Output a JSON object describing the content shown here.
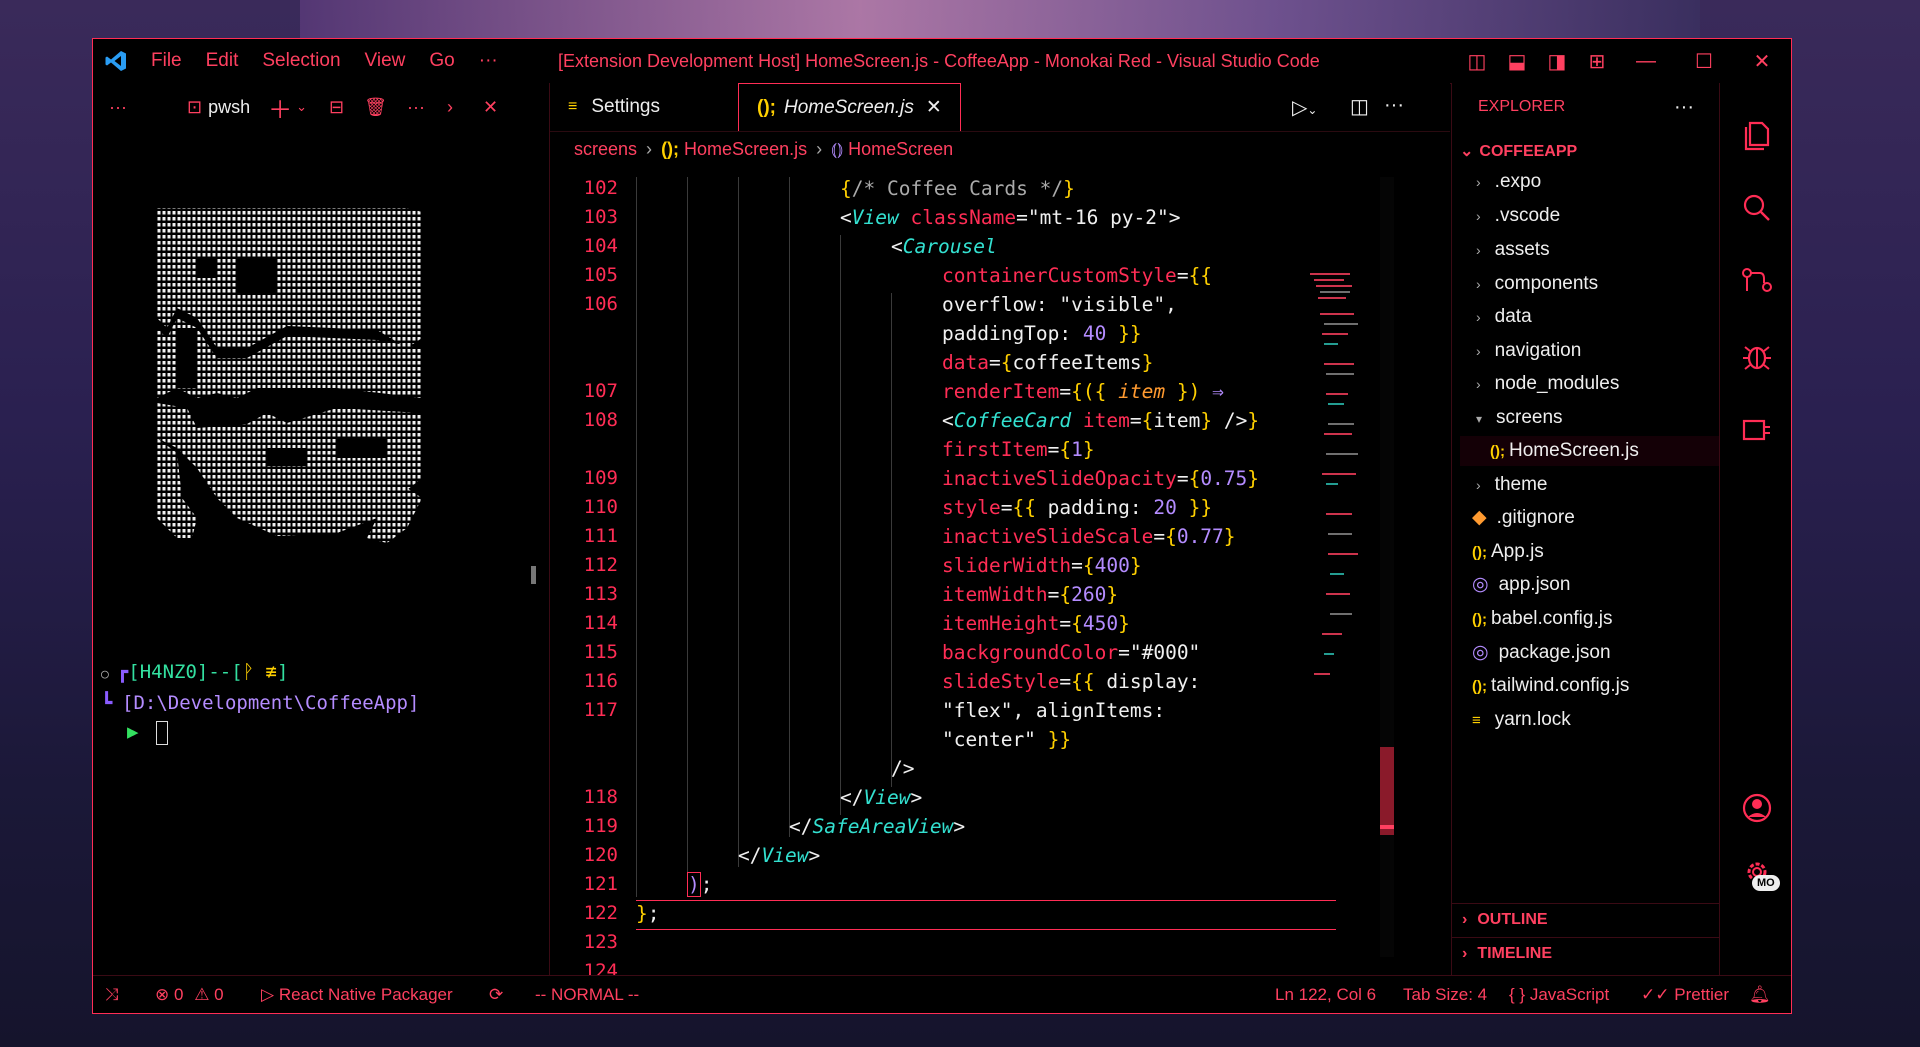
{
  "window": {
    "title": "[Extension Development Host] HomeScreen.js - CoffeeApp - Monokai Red - Visual Studio Code",
    "menu": [
      "File",
      "Edit",
      "Selection",
      "View",
      "Go",
      "···"
    ]
  },
  "terminal": {
    "shell": "pwsh",
    "prompt_user": "[H4NZ0]--[",
    "prompt_git": "ᚹ ≢",
    "prompt_user_end": "]",
    "prompt_path": "[D:\\Development\\CoffeeApp]",
    "prompt_caret": "▶"
  },
  "editor": {
    "tabs": [
      {
        "label": "Settings",
        "icon": "settings-file-icon"
      },
      {
        "label": "HomeScreen.js",
        "icon": "js-file-icon",
        "active": true
      }
    ],
    "breadcrumb": [
      "screens",
      "HomeScreen.js",
      "HomeScreen"
    ],
    "breadcrumb_seps": [
      "›",
      "›"
    ],
    "line_numbers": [
      "102",
      "103",
      "104",
      "105",
      "106",
      "107",
      "108",
      "109",
      "110",
      "111",
      "112",
      "113",
      "114",
      "115",
      "116",
      "117",
      "118",
      "119",
      "120",
      "121",
      "122",
      "123",
      "124"
    ],
    "current_line": "122"
  },
  "explorer": {
    "header": "EXPLORER",
    "root": "COFFEEAPP",
    "items": [
      {
        "label": ".expo",
        "type": "folder"
      },
      {
        "label": ".vscode",
        "type": "folder"
      },
      {
        "label": "assets",
        "type": "folder"
      },
      {
        "label": "components",
        "type": "folder"
      },
      {
        "label": "data",
        "type": "folder"
      },
      {
        "label": "navigation",
        "type": "folder"
      },
      {
        "label": "node_modules",
        "type": "folder"
      },
      {
        "label": "screens",
        "type": "folder-open"
      },
      {
        "label": "HomeScreen.js",
        "type": "js",
        "selected": true
      },
      {
        "label": "theme",
        "type": "folder"
      },
      {
        "label": ".gitignore",
        "type": "git"
      },
      {
        "label": "App.js",
        "type": "js"
      },
      {
        "label": "app.json",
        "type": "json"
      },
      {
        "label": "babel.config.js",
        "type": "js"
      },
      {
        "label": "package.json",
        "type": "json"
      },
      {
        "label": "tailwind.config.js",
        "type": "js"
      },
      {
        "label": "yarn.lock",
        "type": "lock"
      }
    ],
    "outline": "OUTLINE",
    "timeline": "TIMELINE"
  },
  "statusbar": {
    "errors": "0",
    "warnings": "0",
    "packager": "React Native Packager",
    "mode": "-- NORMAL --",
    "position": "Ln 122, Col 6",
    "tab_size": "Tab Size: 4",
    "language": "JavaScript",
    "formatter": "Prettier"
  },
  "activity_badge": "MO",
  "colors": {
    "accent": "#ff2d55",
    "component": "#33e0d0",
    "brace": "#ffd000",
    "number": "#b48cff"
  }
}
